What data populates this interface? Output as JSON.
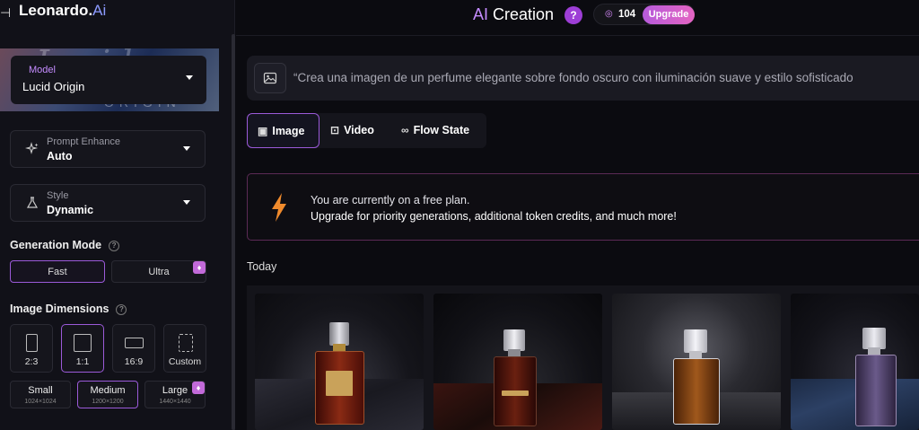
{
  "sidebar": {
    "brand_name": "Leonardo.",
    "brand_suffix": "Ai",
    "collapse_glyph": "⊣",
    "model_card": {
      "ghost_text": "Lucid",
      "ghost_sub": "ORIGIN"
    },
    "model": {
      "label": "Model",
      "value": "Lucid Origin"
    },
    "prompt_enhance": {
      "label": "Prompt Enhance",
      "value": "Auto"
    },
    "style": {
      "label": "Style",
      "value": "Dynamic"
    },
    "generation_mode": {
      "title": "Generation Mode",
      "options": [
        "Fast",
        "Ultra"
      ],
      "selected": "Fast"
    },
    "image_dimensions": {
      "title": "Image Dimensions",
      "ratios": [
        "2:3",
        "1:1",
        "16:9",
        "Custom"
      ],
      "selected_ratio": "1:1",
      "sizes": [
        {
          "label": "Small",
          "sub": "1024×1024"
        },
        {
          "label": "Medium",
          "sub": "1200×1200"
        },
        {
          "label": "Large",
          "sub": "1440×1440"
        }
      ],
      "selected_size": "Medium"
    }
  },
  "header": {
    "title_prefix": "AI",
    "title_rest": " Creation",
    "help": "?",
    "tokens": "104",
    "upgrade_label": "Upgrade"
  },
  "prompt": {
    "text": "“Crea una imagen de un perfume elegante sobre fondo oscuro con iluminación suave y estilo sofisticado"
  },
  "tabs": [
    {
      "label": "Image",
      "icon": "image-icon",
      "active": true
    },
    {
      "label": "Video",
      "icon": "video-icon",
      "active": false
    },
    {
      "label": "Flow State",
      "icon": "infinity-icon",
      "active": false
    }
  ],
  "banner": {
    "line1": "You are currently on a free plan.",
    "line2": "Upgrade for priority generations, additional token credits, and much more!",
    "accent": "#f08a2c"
  },
  "gallery": {
    "section_label": "Today",
    "images": [
      {
        "subject": "amber perfume bottle",
        "liquid": "#7a2012"
      },
      {
        "subject": "red perfume bottle",
        "liquid": "#5e1a10"
      },
      {
        "subject": "amber perfume bottle smoke",
        "liquid": "#8a4a1a"
      },
      {
        "subject": "violet perfume bottle",
        "liquid": "#5b4a78"
      }
    ]
  },
  "colors": {
    "accent_purple": "#9b5ad9",
    "upgrade_gradient_start": "#b65bdb",
    "upgrade_gradient_end": "#e464c2"
  }
}
